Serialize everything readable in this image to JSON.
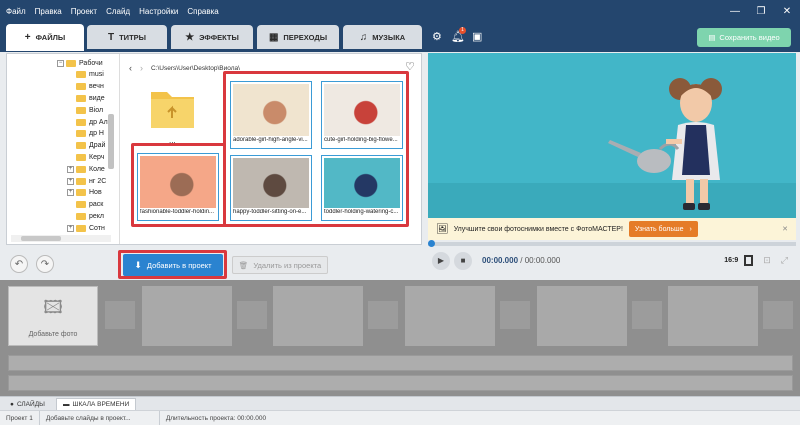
{
  "menu": [
    "Файл",
    "Правка",
    "Проект",
    "Слайд",
    "Настройки",
    "Справка"
  ],
  "tabs": [
    {
      "label": "ФАЙЛЫ",
      "icon": "+"
    },
    {
      "label": "ТИТРЫ",
      "icon": "T"
    },
    {
      "label": "ЭФФЕКТЫ",
      "icon": "★"
    },
    {
      "label": "ПЕРЕХОДЫ",
      "icon": "▦"
    },
    {
      "label": "МУЗЫКА",
      "icon": "♫"
    }
  ],
  "notifications": {
    "count": "1"
  },
  "save_video_label": "Сохранить видео",
  "tree": [
    {
      "label": "Рабочи",
      "expander": "−"
    },
    {
      "label": "musi",
      "expander": ""
    },
    {
      "label": "вечн",
      "expander": ""
    },
    {
      "label": "виде",
      "expander": ""
    },
    {
      "label": "Віол",
      "expander": ""
    },
    {
      "label": "др Ал",
      "expander": ""
    },
    {
      "label": "др Н",
      "expander": ""
    },
    {
      "label": "Драй",
      "expander": ""
    },
    {
      "label": "Керч",
      "expander": ""
    },
    {
      "label": "Коле",
      "expander": "+"
    },
    {
      "label": "нг 2С",
      "expander": "+"
    },
    {
      "label": "Нов",
      "expander": "+"
    },
    {
      "label": "раск",
      "expander": ""
    },
    {
      "label": "рекл",
      "expander": ""
    },
    {
      "label": "Сотн",
      "expander": "+"
    }
  ],
  "browser": {
    "path": "C:\\Users\\User\\Desktop\\Виола\\",
    "files": [
      {
        "caption": "adorable-girl-high-angle-vi...",
        "colors": [
          "#f0e4cf",
          "#c98b6a"
        ]
      },
      {
        "caption": "cute-girl-holding-big-flowe...",
        "colors": [
          "#efe9e2",
          "#c8423a"
        ]
      },
      {
        "caption": "fashionable-toddler-holdin...",
        "colors": [
          "#f5a788",
          "#9c6c55"
        ]
      },
      {
        "caption": "happy-toddler-sitting-on-e...",
        "colors": [
          "#bfb8b0",
          "#5e4a40"
        ]
      },
      {
        "caption": "toddler-holding-watering-c...",
        "colors": [
          "#52b8c6",
          "#243864"
        ]
      }
    ]
  },
  "add_to_project": "Добавить в проект",
  "delete_from_project": "Удалить из проекта",
  "promo": {
    "text": "Улучшите свои фотоснимки вместе с ФотоМАСТЕР!",
    "button": "Узнать больше"
  },
  "player": {
    "current": "00:00.000",
    "total": "/ 00:00.000",
    "ratio": "16:9"
  },
  "timeline": {
    "add_photo": "Добавьте фото"
  },
  "bottom_tabs": [
    "СЛАЙДЫ",
    "ШКАЛА ВРЕМЕНИ"
  ],
  "status": {
    "project": "Проект 1",
    "hint": "Добавьте слайды в проект...",
    "duration": "Длительность проекта: 00:00.000"
  },
  "colors": {
    "titlebar": "#24466e",
    "accent": "#2a83d0",
    "highlight": "#d9383e",
    "preview_bg": "#42b6c8"
  }
}
